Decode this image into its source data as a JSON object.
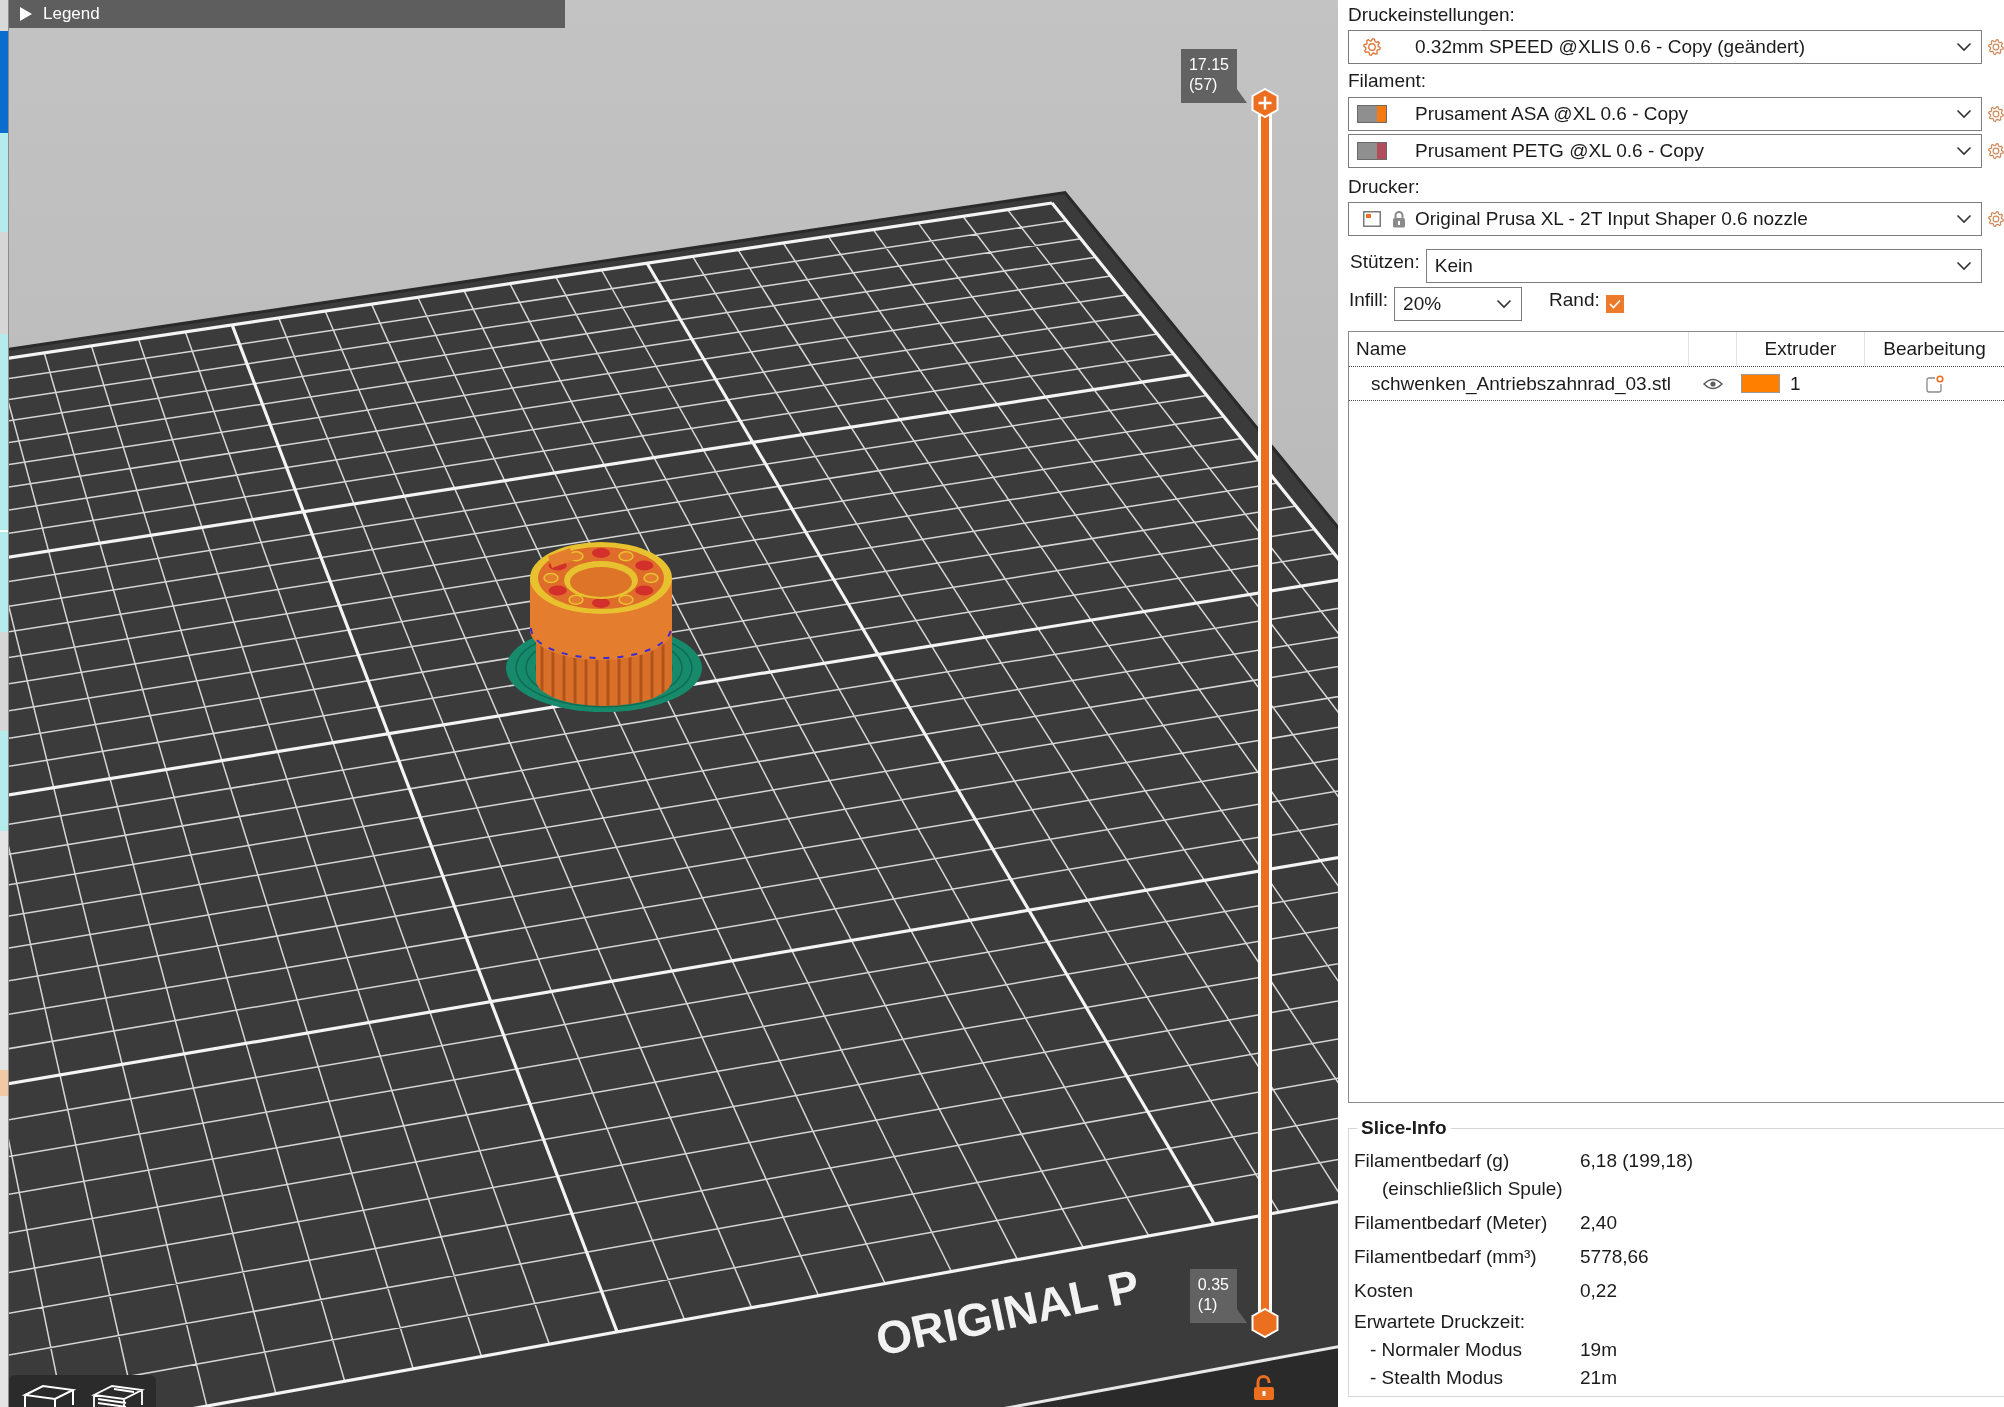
{
  "viewport": {
    "legend": {
      "label": "Legend",
      "expanded": false
    },
    "bed_logo": "ORIGINAL P",
    "layer_slider": {
      "handles": [
        {
          "selected": true,
          "level": 1,
          "value": "17.15",
          "layer": "(57)"
        },
        {
          "selected": false,
          "level": 0,
          "value": "0.35",
          "layer": "(1)"
        }
      ]
    }
  },
  "print_settings": {
    "label": "Druckeinstellungen:",
    "preset": "0.32mm SPEED @XLIS 0.6 - Copy (geändert)"
  },
  "filament": {
    "label": "Filament:",
    "presets": [
      {
        "name": "Prusament ASA @XL 0.6 - Copy",
        "color": "#f47b13"
      },
      {
        "name": "Prusament PETG @XL 0.6 - Copy",
        "color": "#b24e5c"
      }
    ]
  },
  "printer": {
    "label": "Drucker:",
    "preset": "Original Prusa XL - 2T Input Shaper 0.6 nozzle",
    "locked": true
  },
  "supports": {
    "label": "Stützen:",
    "value": "Kein"
  },
  "infill": {
    "label": "Infill:",
    "value": "20%"
  },
  "brim": {
    "label": "Rand:",
    "checked": true
  },
  "objects": {
    "columns": [
      {
        "kind": "name",
        "label": "Name"
      },
      {
        "kind": "visibility"
      },
      {
        "kind": "extruder",
        "label": "Extruder"
      },
      {
        "kind": "edit",
        "label": "Bearbeitung"
      }
    ],
    "rows": [
      {
        "name": "schwenken_Antriebszahnrad_03.stl",
        "visible": true,
        "color": "#ff7f00",
        "extruder": "1",
        "focused": true
      }
    ]
  },
  "slice_info": {
    "title": "Slice-Info",
    "rows": [
      {
        "kind": "main",
        "label": "Filamentbedarf (g)",
        "value": "6,18 (199,18)"
      },
      {
        "kind": "note",
        "label": "(einschließlich Spule)"
      },
      {
        "kind": "main",
        "label": "Filamentbedarf (Meter)",
        "value": "2,40"
      },
      {
        "kind": "main",
        "label": "Filamentbedarf (mm³)",
        "value": "5778,66"
      },
      {
        "kind": "main",
        "label": "Kosten",
        "value": "0,22"
      },
      {
        "kind": "heading",
        "label": "Erwartete Druckzeit:"
      },
      {
        "kind": "sub",
        "label": "- Normaler Modus",
        "value": "19m"
      },
      {
        "kind": "sub",
        "label": "- Stealth Modus",
        "value": "21m"
      }
    ]
  }
}
